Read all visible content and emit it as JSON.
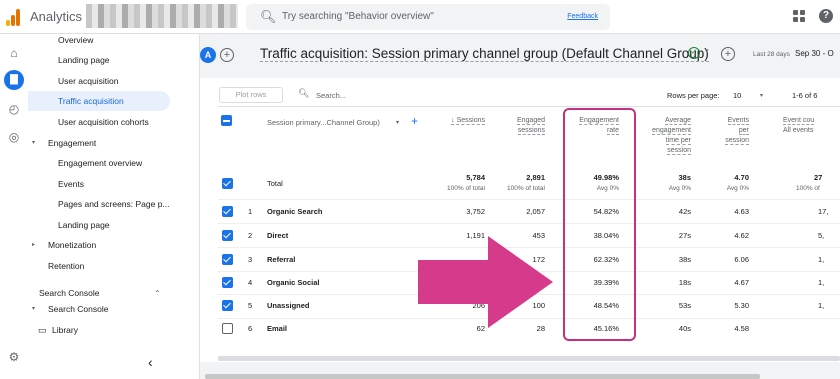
{
  "app": {
    "title": "Analytics",
    "search_placeholder": "Try searching \"Behavior overview\"",
    "feedback": "Feedback",
    "logo_colors": [
      "#f9ab00",
      "#e37400",
      "#e37400"
    ]
  },
  "nav": {
    "items": [
      {
        "label": "Overview",
        "indent": 2
      },
      {
        "label": "Landing page",
        "indent": 2
      },
      {
        "label": "User acquisition",
        "indent": 2
      },
      {
        "label": "Traffic acquisition",
        "indent": 2,
        "selected": true
      },
      {
        "label": "User acquisition cohorts",
        "indent": 2
      },
      {
        "label": "Engagement",
        "indent": 1,
        "expanded": true
      },
      {
        "label": "Engagement overview",
        "indent": 2
      },
      {
        "label": "Events",
        "indent": 2
      },
      {
        "label": "Pages and screens: Page p...",
        "indent": 2
      },
      {
        "label": "Landing page",
        "indent": 2
      },
      {
        "label": "Monetization",
        "indent": 1,
        "expanded": false
      },
      {
        "label": "Retention",
        "indent": 1
      },
      {
        "label": "Search Console",
        "indent": 0
      },
      {
        "label": "Search Console",
        "indent": 1,
        "expanded": true
      },
      {
        "label": "Library",
        "indent": 0,
        "icon": "folder-icon"
      }
    ]
  },
  "header": {
    "avatar": "A",
    "title": "Traffic acquisition: Session primary channel group (Default Channel Group)",
    "date_label": "Last 28 days",
    "date_value": "Sep 30 - O"
  },
  "toolbar": {
    "plot_rows": "Plot rows",
    "search_placeholder": "Search...",
    "rows_per_page_label": "Rows per page:",
    "rows_per_page": "10",
    "range": "1-6 of 6"
  },
  "table": {
    "dimension_header": "Session primary...Channel Group)",
    "columns": [
      {
        "label": "↓ Sessions",
        "lines": [
          "↓ Sessions"
        ]
      },
      {
        "label": "Engaged sessions",
        "lines": [
          "Engaged",
          "sessions"
        ]
      },
      {
        "label": "Engagement rate",
        "lines": [
          "Engagement",
          "rate"
        ]
      },
      {
        "label": "Average engagement time per session",
        "lines": [
          "Average",
          "engagement",
          "time per",
          "session"
        ]
      },
      {
        "label": "Events per session",
        "lines": [
          "Events",
          "per",
          "session"
        ]
      },
      {
        "label": "Event count All events",
        "lines": [
          "Event cou",
          "All events"
        ]
      }
    ],
    "total": {
      "label": "Total",
      "values": [
        "5,784",
        "2,891",
        "49.98%",
        "38s",
        "4.70",
        "27"
      ],
      "subs": [
        "100% of total",
        "100% of total",
        "Avg 0%",
        "Avg 0%",
        "Avg 0%",
        "100% of"
      ]
    },
    "rows": [
      {
        "num": "1",
        "name": "Organic Search",
        "checked": true,
        "values": [
          "3,752",
          "2,057",
          "54.82%",
          "42s",
          "4.63",
          "17,"
        ]
      },
      {
        "num": "2",
        "name": "Direct",
        "checked": true,
        "values": [
          "1,191",
          "453",
          "38.04%",
          "27s",
          "4.62",
          "5,"
        ]
      },
      {
        "num": "3",
        "name": "Referral",
        "checked": true,
        "values": [
          "",
          "172",
          "62.32%",
          "38s",
          "6.06",
          "1,"
        ]
      },
      {
        "num": "4",
        "name": "Organic Social",
        "checked": true,
        "values": [
          "",
          "",
          "39.39%",
          "18s",
          "4.67",
          "1,"
        ]
      },
      {
        "num": "5",
        "name": "Unassigned",
        "checked": true,
        "values": [
          "206",
          "100",
          "48.54%",
          "53s",
          "5.30",
          "1,"
        ]
      },
      {
        "num": "6",
        "name": "Email",
        "checked": false,
        "values": [
          "62",
          "28",
          "45.16%",
          "40s",
          "4.58",
          ""
        ]
      }
    ]
  },
  "colors": {
    "accent": "#1a73e8",
    "highlight": "#c6307f",
    "arrow": "#d63a8a"
  }
}
